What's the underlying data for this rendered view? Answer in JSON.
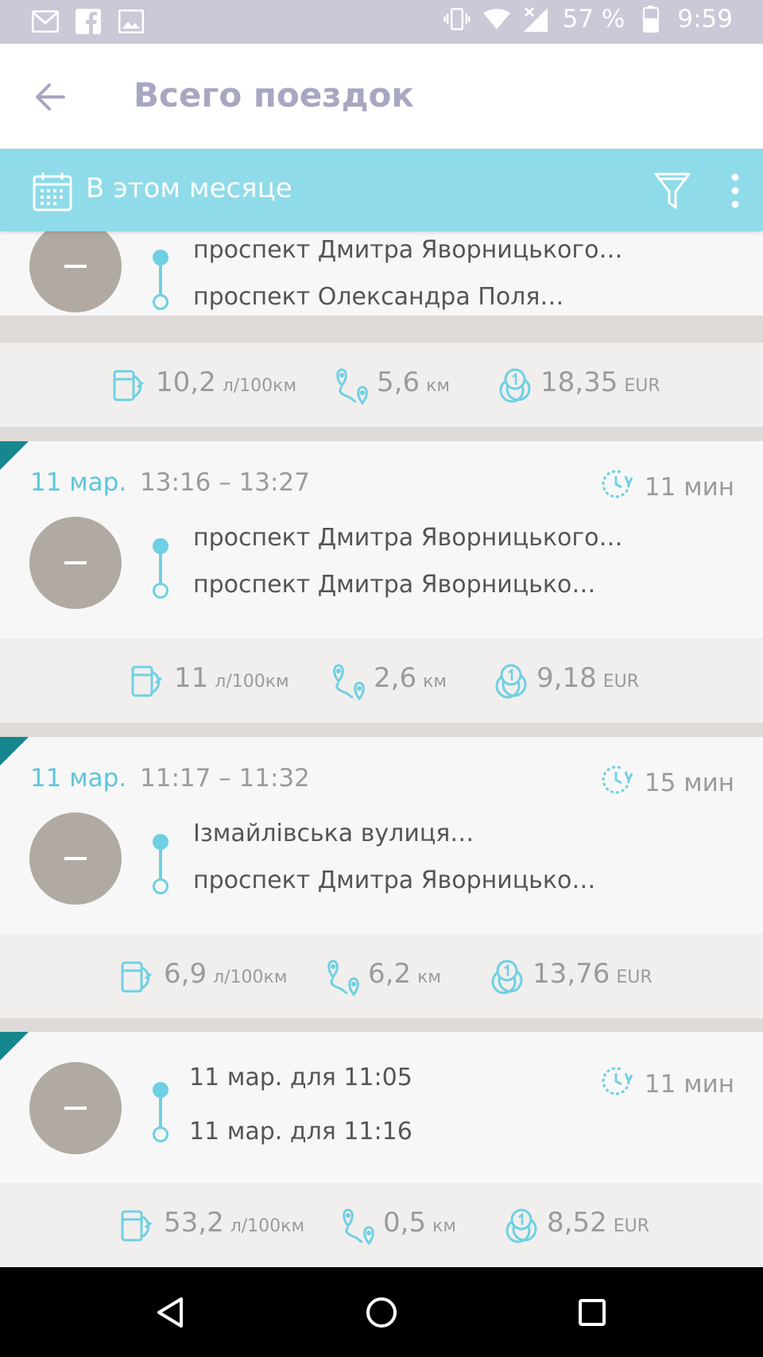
{
  "status_bar": {
    "battery": "57 %",
    "time": "9:59",
    "left_icons": [
      "gmail-icon",
      "facebook-icon",
      "image-icon"
    ],
    "right_icons": [
      "vibrate-icon",
      "wifi-icon",
      "no-signal-icon",
      "battery-icon"
    ]
  },
  "app_bar": {
    "title": "Всего поездок",
    "back_icon": "arrow-left-icon"
  },
  "filter_bar": {
    "period": "В этом месяце",
    "calendar_icon": "calendar-icon",
    "filter_icon": "funnel-icon",
    "menu_icon": "more-vert-icon"
  },
  "colors": {
    "accent": "#8fdbe9",
    "teal": "#16868f",
    "route": "#6fd0e3",
    "avatar": "#b0aaa3"
  },
  "trips": [
    {
      "from": "проспект Дмитра Яворницького…",
      "to": "проспект Олександра Поля…",
      "consumption": "10,2",
      "consumption_unit": "л/100км",
      "distance": "5,6",
      "distance_unit": "км",
      "cost": "18,35",
      "cost_unit": "EUR"
    },
    {
      "date": "11 мар.",
      "time": "13:16 – 13:27",
      "duration": "11 мин",
      "from": "проспект Дмитра Яворницького…",
      "to": "проспект Дмитра Яворницько…",
      "consumption": "11",
      "consumption_unit": "л/100км",
      "distance": "2,6",
      "distance_unit": "км",
      "cost": "9,18",
      "cost_unit": "EUR"
    },
    {
      "date": "11 мар.",
      "time": "11:17 – 11:32",
      "duration": "15 мин",
      "from": "Ізмайлівська вулиця…",
      "to": "проспект Дмитра Яворницько…",
      "consumption": "6,9",
      "consumption_unit": "л/100км",
      "distance": "6,2",
      "distance_unit": "км",
      "cost": "13,76",
      "cost_unit": "EUR"
    },
    {
      "duration": "11 мин",
      "from": "11 мар. для 11:05",
      "to": "11 мар. для 11:16",
      "consumption": "53,2",
      "consumption_unit": "л/100км",
      "distance": "0,5",
      "distance_unit": "км",
      "cost": "8,52",
      "cost_unit": "EUR"
    }
  ],
  "nav_bar": {
    "icons": [
      "back-triangle-icon",
      "home-circle-icon",
      "recents-square-icon"
    ]
  }
}
